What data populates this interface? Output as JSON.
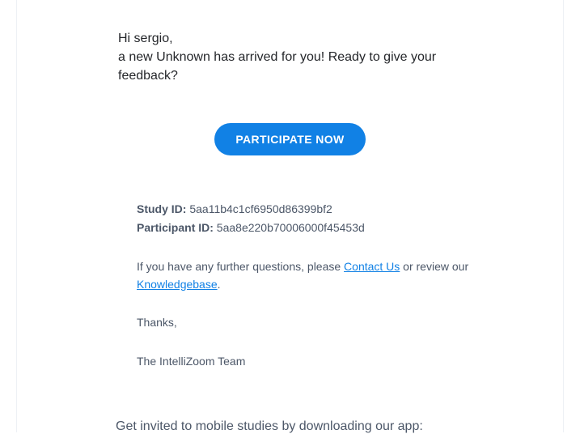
{
  "greeting": {
    "line1": "Hi sergio,",
    "line2": "a new Unknown has arrived for you! Ready to give your feedback?"
  },
  "cta": {
    "label": "PARTICIPATE NOW"
  },
  "ids": {
    "study_label": "Study ID:",
    "study_value": "5aa11b4c1cf6950d86399bf2",
    "participant_label": "Participant ID:",
    "participant_value": "5aa8e220b70006000f45453d"
  },
  "support": {
    "prefix": "If you have any further questions, please ",
    "contact_link": "Contact Us",
    "mid": " or review our ",
    "kb_link": "Knowledgebase",
    "suffix": "."
  },
  "closing": {
    "thanks": "Thanks,",
    "signature": "The IntelliZoom Team"
  },
  "footer": {
    "invite": "Get invited to mobile studies by downloading our app:"
  }
}
